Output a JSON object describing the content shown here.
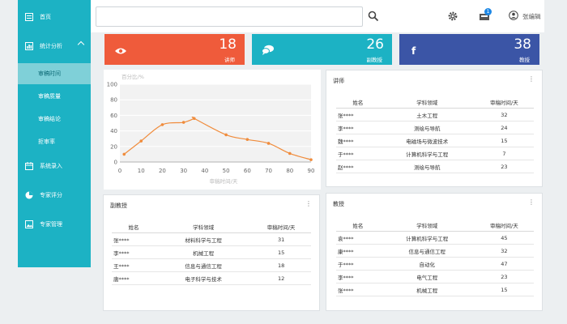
{
  "sidebar": {
    "items": [
      {
        "label": "首页",
        "icon": "home-icon"
      },
      {
        "label": "统计分析",
        "icon": "chart-icon"
      },
      {
        "label": "系统录入",
        "icon": "calendar-icon"
      },
      {
        "label": "专家评分",
        "icon": "pie-icon"
      },
      {
        "label": "专家管理",
        "icon": "image-icon"
      }
    ],
    "sub_items": [
      "审稿时间",
      "审稿质量",
      "审稿结论",
      "拒审率"
    ]
  },
  "header": {
    "search_placeholder": "",
    "notification_count": "1",
    "user_name": "张编辑"
  },
  "stats": [
    {
      "value": "18",
      "label": "讲师",
      "color": "#ef5b3b",
      "icon": "eye-icon"
    },
    {
      "value": "26",
      "label": "副教授",
      "color": "#1cb2c4",
      "icon": "chat-icon"
    },
    {
      "value": "38",
      "label": "教授",
      "color": "#3b55a6",
      "icon": "facebook-icon"
    }
  ],
  "chart_data": {
    "type": "line",
    "ylabel": "百分比/%",
    "xlabel": "审稿时间/天",
    "x": [
      2,
      10,
      20,
      30,
      35,
      50,
      60,
      70,
      80,
      90
    ],
    "y": [
      10,
      27,
      48,
      51,
      56,
      35,
      29,
      24,
      11,
      3
    ],
    "smooth_peak": {
      "x": 35,
      "y": 56
    },
    "xlim": [
      0,
      90
    ],
    "ylim": [
      0,
      100
    ],
    "xticks": [
      "0",
      "10",
      "20",
      "30",
      "40",
      "50",
      "60",
      "70",
      "80",
      "90"
    ],
    "yticks": [
      "0",
      "20",
      "40",
      "60",
      "80",
      "100"
    ],
    "color": "#f08c3c",
    "grid": true
  },
  "lecturer": {
    "title": "讲师",
    "headers": [
      "姓名",
      "学科领域",
      "审稿时间/天"
    ],
    "rows": [
      [
        "张****",
        "土木工程",
        "32"
      ],
      [
        "李****",
        "测绘与导航",
        "24"
      ],
      [
        "魏****",
        "电磁场与微波技术",
        "15"
      ],
      [
        "于****",
        "计算机科学与工程",
        "7"
      ],
      [
        "赵****",
        "测绘与导航",
        "23"
      ]
    ]
  },
  "associate": {
    "title": "副教授",
    "headers": [
      "姓名",
      "学科领域",
      "审稿时间/天"
    ],
    "rows": [
      [
        "张****",
        "材料科学与工程",
        "31"
      ],
      [
        "李****",
        "机械工程",
        "15"
      ],
      [
        "王****",
        "信息与通信工程",
        "18"
      ],
      [
        "唐****",
        "电子科学与技术",
        "12"
      ]
    ]
  },
  "professor": {
    "title": "教授",
    "headers": [
      "姓名",
      "学科领域",
      "审稿时间/天"
    ],
    "rows": [
      [
        "袁****",
        "计算机科学与工程",
        "45"
      ],
      [
        "康****",
        "信息与通信工程",
        "32"
      ],
      [
        "于****",
        "自动化",
        "47"
      ],
      [
        "李****",
        "电气工程",
        "23"
      ],
      [
        "张****",
        "机械工程",
        "15"
      ]
    ]
  }
}
